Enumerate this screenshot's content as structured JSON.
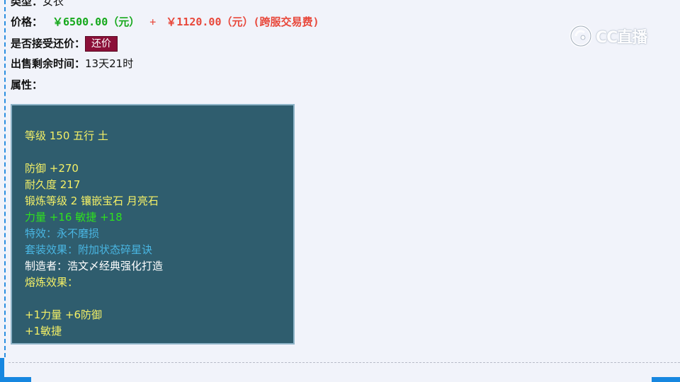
{
  "fields": {
    "type_label": "类型：",
    "type_value": "女衣",
    "price_label": "价格：",
    "price_main": "￥6500.00（元）",
    "price_plus": "+",
    "price_fee": "￥1120.00（元）(跨服交易费)",
    "counter_label": "是否接受还价：",
    "counter_button": "还价",
    "remaining_label": "出售剩余时间：",
    "remaining_value": "13天21时",
    "attr_label": "属性："
  },
  "attributes": [
    {
      "text": "等级 150 五行 土",
      "color": "yellow"
    },
    {
      "text": "",
      "color": "yellow"
    },
    {
      "text": "防御 +270",
      "color": "yellow"
    },
    {
      "text": "耐久度 217",
      "color": "yellow"
    },
    {
      "text": "锻炼等级 2 镶嵌宝石 月亮石",
      "color": "yellow"
    },
    {
      "text": "力量 +16 敏捷 +18",
      "color": "green"
    },
    {
      "text": "特效：永不磨损",
      "color": "blue"
    },
    {
      "text": "套装效果：附加状态碎星诀",
      "color": "blue"
    },
    {
      "text": "制造者：浩文〆经典强化打造",
      "color": "white"
    },
    {
      "text": "熔炼效果：",
      "color": "yellow"
    },
    {
      "text": "",
      "color": "yellow"
    },
    {
      "text": "+1力量 +6防御",
      "color": "yellow"
    },
    {
      "text": "+1敏捷",
      "color": "yellow"
    }
  ],
  "watermark": {
    "text": "CC直播",
    "icon": "cc-logo-icon"
  },
  "colors": {
    "yellow": "#f4f066",
    "green": "#2ee21e",
    "blue": "#49b6e3",
    "white": "#ffffff",
    "box_bg": "#2f5d6e",
    "button_bg": "#8b1038"
  }
}
